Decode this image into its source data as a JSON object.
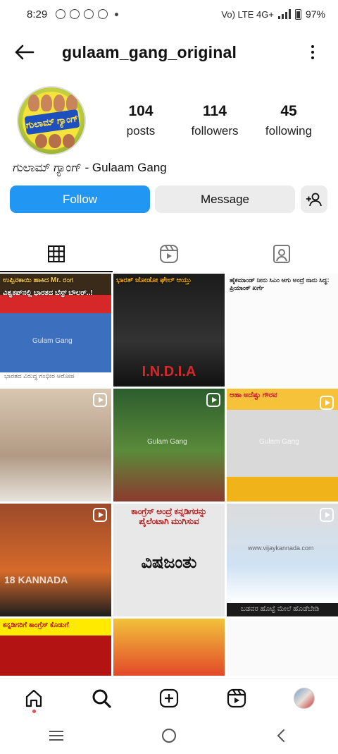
{
  "status_bar": {
    "time": "8:29",
    "network": "Vo) LTE 4G+",
    "battery": "97%"
  },
  "header": {
    "username": "gulaam_gang_original"
  },
  "profile": {
    "avatar_text": "ಗುಲಾಮ್ ಗ್ಯಾಂಗ್",
    "stats": [
      {
        "value": "104",
        "label": "posts"
      },
      {
        "value": "114",
        "label": "followers"
      },
      {
        "value": "45",
        "label": "following"
      }
    ],
    "display_name": "ಗುಲಾಮ್ ಗ್ಯಾಂಗ್ - Gulaam Gang"
  },
  "actions": {
    "follow": "Follow",
    "message": "Message"
  },
  "posts": [
    {
      "caption": "ಉಪ್ಪಿನಕಾಯಿ ಹಾಕಿದ Mr. ರಂಗ",
      "subcaption": "ವಿಶ್ವಕಪ್‌ನಲ್ಲಿ ಭಾರತದ ಬೆಸ್ಟ್ ಬೌಲರ್..!",
      "watermark": "Gulam Gang",
      "footer": "ಭಾರತದ ವಿರುದ್ಧ ಗಂಭೀರ ಆರೋಪ",
      "reel": false
    },
    {
      "caption": "ಭಾರತ್ ಜೋಡೋ ಘೇಲ್ ಆಯ್ತು",
      "footer": "I.N.D.I.A",
      "reel": false
    },
    {
      "caption": "ಹೈಕಮಾಂಡ್ ನೀನು ಸಿಎಂ ಆಗು ಅಂದ್ರೆ ನಾನು ಸಿದ್ಧ: ಪ್ರಿಯಾಂಕ್ ಖರ್ಗೆ",
      "reel": false
    },
    {
      "caption": "",
      "reel": true
    },
    {
      "caption": "",
      "watermark": "Gulam Gang",
      "reel": true
    },
    {
      "caption": "ಆಹಾ ಅದೆಷ್ಟು ಗೌರವ",
      "watermark": "Gulam Gang",
      "reel": true
    },
    {
      "caption": "",
      "watermark": "18 KANNADA",
      "reel": true
    },
    {
      "caption": "ಕಾಂಗ್ರೆಸ್ ಅಂದ್ರೆ ಕನ್ನಡಿಗರನ್ನು ಪೈಲೆಂಟಾಗಿ ಮುಗಿಸುವ",
      "footer": "ವಿಷಜಂತು",
      "reel": false
    },
    {
      "caption": "",
      "watermark": "www.vijaykannada.com",
      "footer": "ಬಡವರ ಹೊಟ್ಟೆ ಮೇಲೆ ಹೊಡೆಬೇಡಿ",
      "reel": true
    },
    {
      "caption": "ಕನ್ನಡಿಗರಿಗೆ ಕಾಂಗ್ರೆಸ್ ಕೊಡುಗೆ",
      "reel": false
    },
    {
      "caption": "",
      "reel": false
    },
    {
      "caption": "",
      "reel": false
    }
  ],
  "colors": {
    "follow_button": "#2196f3",
    "secondary_button": "#ececec",
    "notification_dot": "#ed4956"
  }
}
